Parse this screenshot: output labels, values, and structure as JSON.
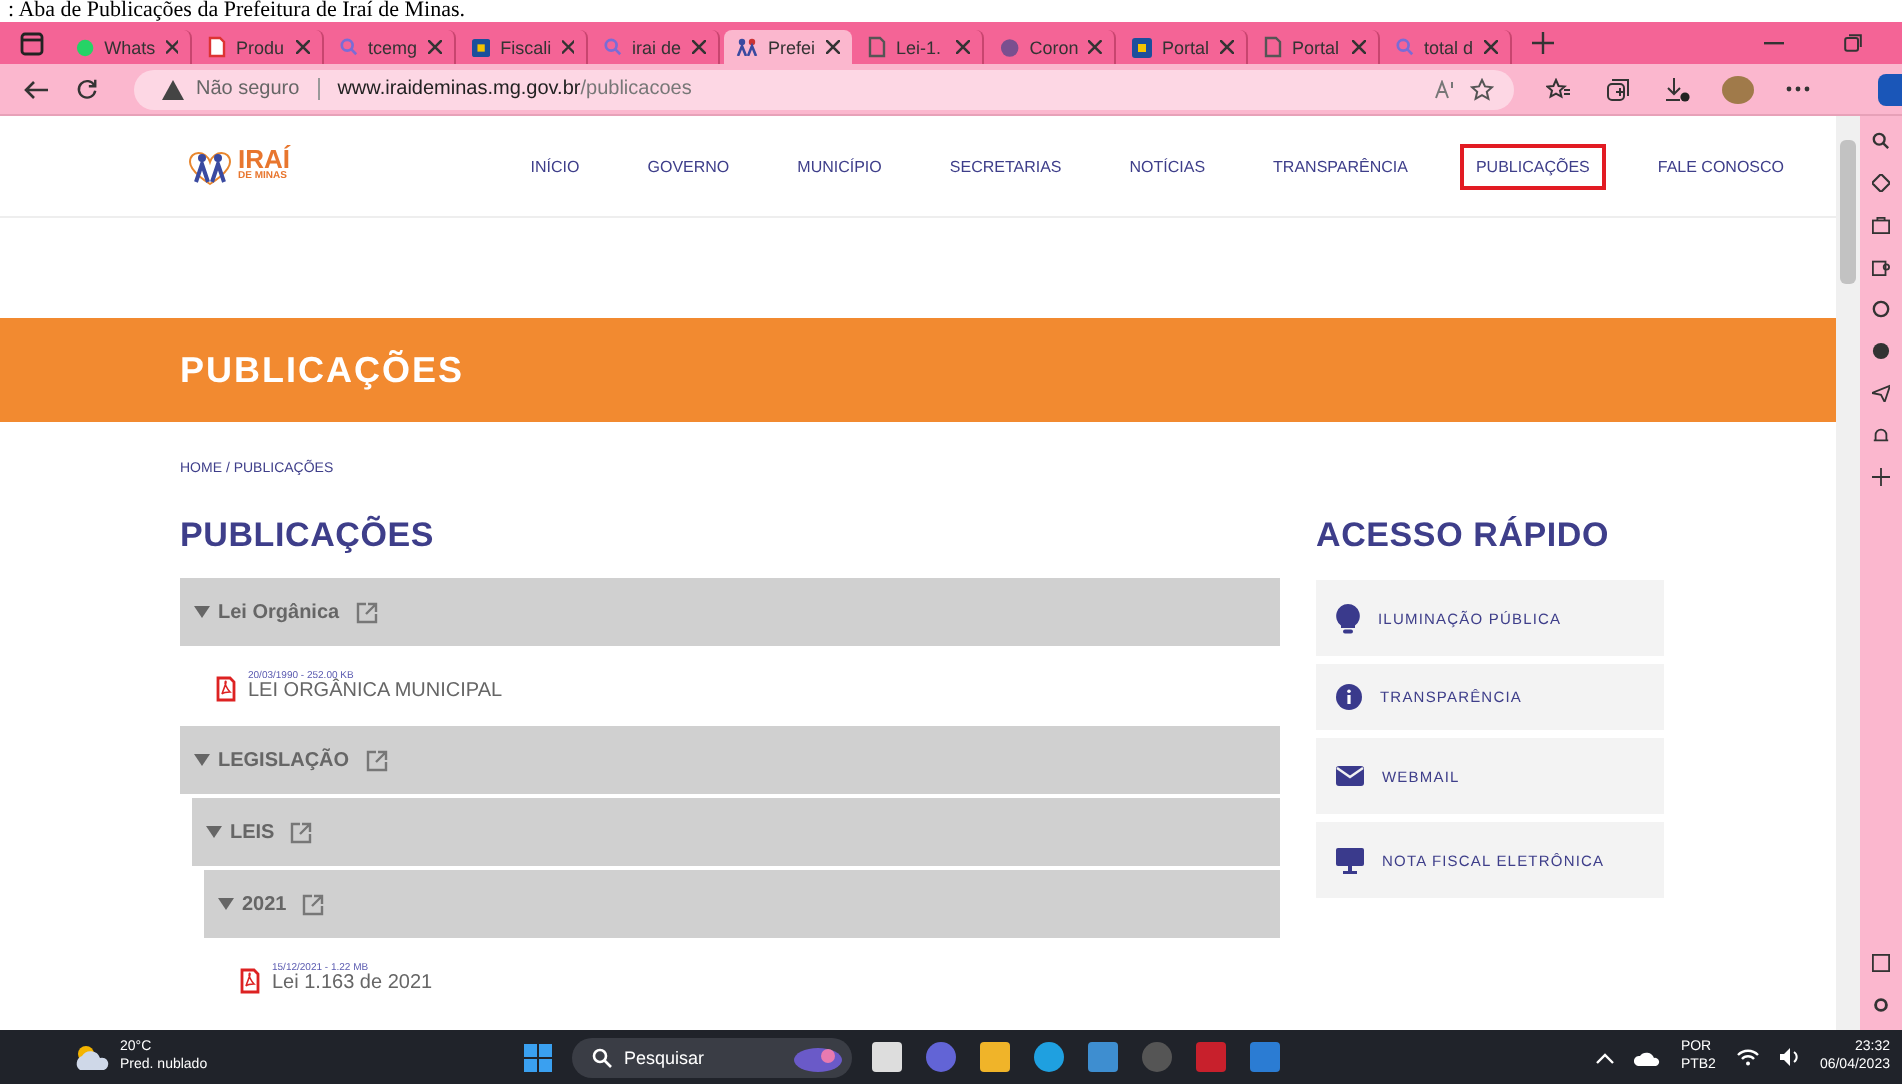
{
  "caption": ": Aba de Publicações da Prefeitura de Iraí de Minas.",
  "browser": {
    "tabs": [
      {
        "label": "Whats",
        "kind": "chat",
        "selected": false
      },
      {
        "label": "Produ",
        "kind": "pdf",
        "selected": false
      },
      {
        "label": "tcemg",
        "kind": "search",
        "selected": false
      },
      {
        "label": "Fiscali",
        "kind": "site",
        "selected": false
      },
      {
        "label": "irai de",
        "kind": "search",
        "selected": false
      },
      {
        "label": "Prefei",
        "kind": "people",
        "selected": true
      },
      {
        "label": "Lei-1.",
        "kind": "page",
        "selected": false
      },
      {
        "label": "Coron",
        "kind": "dot",
        "selected": false
      },
      {
        "label": "Portal",
        "kind": "shield",
        "selected": false
      },
      {
        "label": "Portal",
        "kind": "page",
        "selected": false
      },
      {
        "label": "total d",
        "kind": "search",
        "selected": false
      }
    ],
    "address": {
      "security": "Não seguro",
      "host": "www.iraideminas.mg.gov.br",
      "path": "/publicacoes"
    }
  },
  "site": {
    "logo": {
      "name": "IRAÍ",
      "sub": "DE MINAS"
    },
    "nav": [
      {
        "label": "INÍCIO",
        "highlighted": false
      },
      {
        "label": "GOVERNO",
        "highlighted": false
      },
      {
        "label": "MUNICÍPIO",
        "highlighted": false
      },
      {
        "label": "SECRETARIAS",
        "highlighted": false
      },
      {
        "label": "NOTÍCIAS",
        "highlighted": false
      },
      {
        "label": "TRANSPARÊNCIA",
        "highlighted": false
      },
      {
        "label": "PUBLICAÇÕES",
        "highlighted": true
      },
      {
        "label": "FALE CONOSCO",
        "highlighted": false
      }
    ],
    "banner_title": "PUBLICAÇÕES",
    "breadcrumb": "HOME / PUBLICAÇÕES",
    "heading": "PUBLICAÇÕES",
    "tree": [
      {
        "kind": "folder",
        "label": "Lei Orgânica",
        "expanded": true,
        "children": [
          {
            "kind": "file",
            "meta": "20/03/1990 - 252.00 KB",
            "label": "LEI ORGÂNICA MUNICIPAL"
          }
        ]
      },
      {
        "kind": "folder",
        "label": "LEGISLAÇÃO",
        "expanded": true,
        "children": [
          {
            "kind": "folder",
            "label": "LEIS",
            "expanded": true,
            "children": [
              {
                "kind": "folder",
                "label": "2021",
                "expanded": true,
                "children": [
                  {
                    "kind": "file",
                    "meta": "15/12/2021 - 1.22 MB",
                    "label": "Lei 1.163 de 2021"
                  }
                ]
              }
            ]
          }
        ]
      }
    ],
    "quick_access": {
      "heading": "ACESSO RÁPIDO",
      "items": [
        {
          "kind": "bulb",
          "label": "ILUMINAÇÃO PÚBLICA"
        },
        {
          "kind": "info",
          "label": "TRANSPARÊNCIA"
        },
        {
          "kind": "mail",
          "label": "WEBMAIL"
        },
        {
          "kind": "monitor",
          "label": "NOTA FISCAL ELETRÔNICA"
        }
      ]
    }
  },
  "taskbar": {
    "temperature": "20°C",
    "weather": "Pred. nublado",
    "search_placeholder": "Pesquisar",
    "language": "POR",
    "layout": "PTB2",
    "time": "23:32",
    "date": "06/04/2023"
  }
}
